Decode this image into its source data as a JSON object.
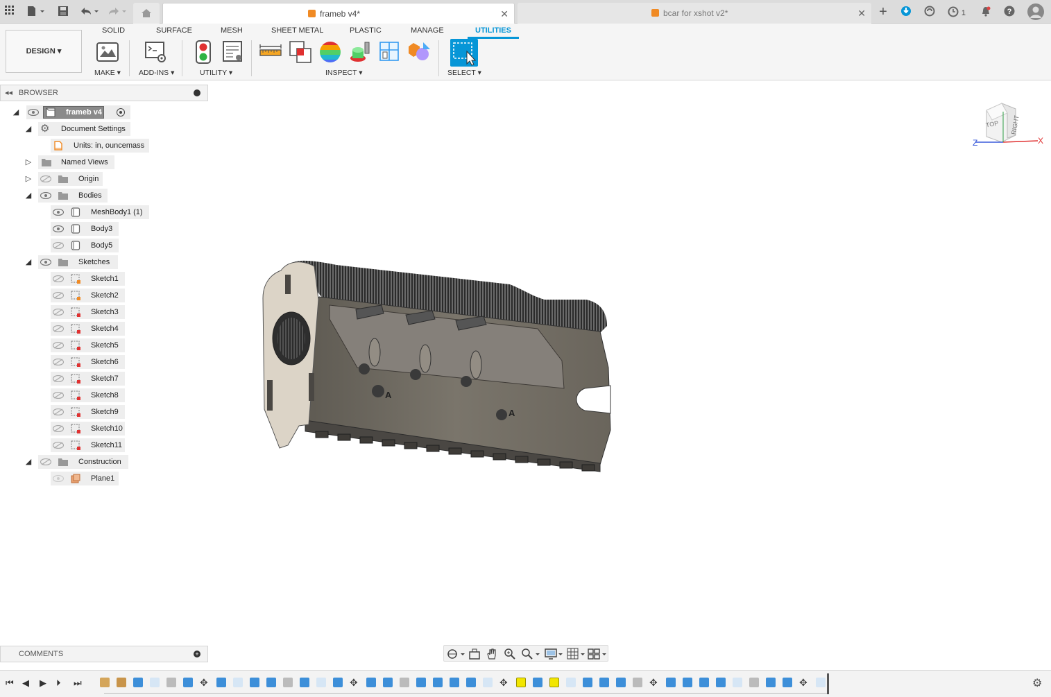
{
  "tabs": [
    {
      "label": "frameb v4*",
      "active": true
    },
    {
      "label": "bcar for xshot v2*",
      "active": false
    }
  ],
  "topbar": {
    "notification_count": "1"
  },
  "ribbon": {
    "workspace_label": "DESIGN",
    "tabs": [
      "SOLID",
      "SURFACE",
      "MESH",
      "SHEET METAL",
      "PLASTIC",
      "MANAGE",
      "UTILITIES"
    ],
    "active_tab": "UTILITIES",
    "groups": [
      "MAKE",
      "ADD-INS",
      "UTILITY",
      "INSPECT",
      "SELECT"
    ]
  },
  "browser": {
    "title": "BROWSER",
    "root": "frameb v4",
    "document_settings": "Document Settings",
    "units": "Units: in, ouncemass",
    "named_views": "Named Views",
    "origin": "Origin",
    "bodies": "Bodies",
    "body_items": [
      "MeshBody1 (1)",
      "Body3",
      "Body5"
    ],
    "sketches": "Sketches",
    "sketch_items": [
      "Sketch1",
      "Sketch2",
      "Sketch3",
      "Sketch4",
      "Sketch5",
      "Sketch6",
      "Sketch7",
      "Sketch8",
      "Sketch9",
      "Sketch10",
      "Sketch11"
    ],
    "construction": "Construction",
    "construction_items": [
      "Plane1"
    ]
  },
  "comments": {
    "title": "COMMENTS"
  },
  "viewcube": {
    "top": "TOP",
    "right": "RIGHT",
    "axis_z": "Z",
    "axis_x": "X"
  },
  "model": {
    "label_a": "A"
  },
  "colors": {
    "accent": "#0696d7",
    "tab_orange": "#f08a24",
    "model_body": "#6f6a60",
    "model_face": "#d9d1c4"
  }
}
